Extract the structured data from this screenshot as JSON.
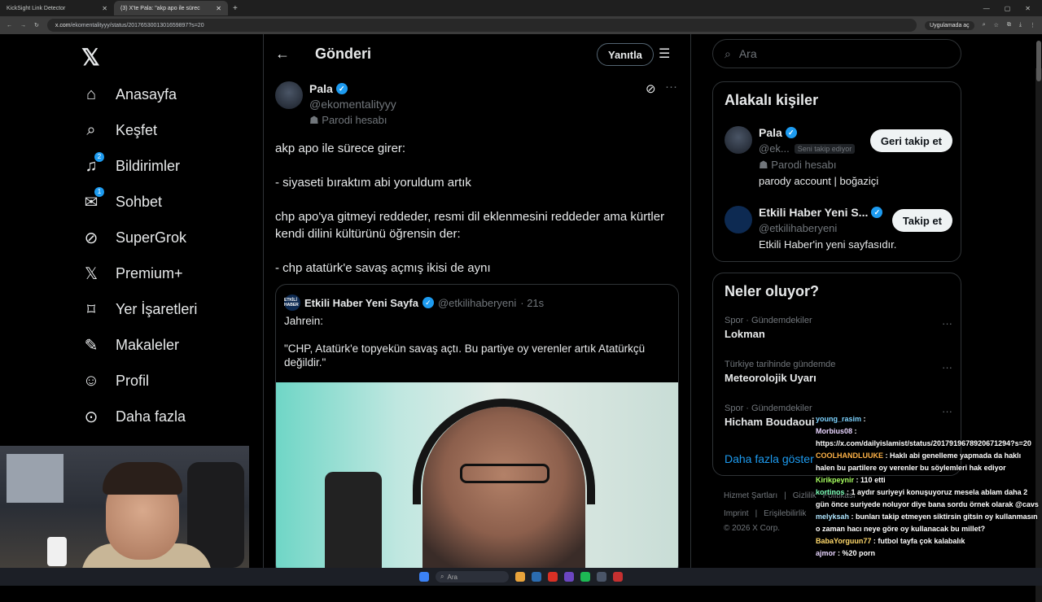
{
  "browser": {
    "tabs": [
      {
        "label": "KickSight Link Detector"
      },
      {
        "label": "(3) X'te Pala: \"akp apo ile sürec"
      }
    ],
    "url_host": "x.com",
    "url_path": "/ekomentalityyy/status/2017653001301659897?s=20",
    "open_in_app": "Uygulamada aç"
  },
  "sidebar": {
    "items": [
      {
        "label": "Anasayfa",
        "icon": "home-icon"
      },
      {
        "label": "Keşfet",
        "icon": "search-icon"
      },
      {
        "label": "Bildirimler",
        "icon": "bell-icon",
        "badge": "2"
      },
      {
        "label": "Sohbet",
        "icon": "mail-icon",
        "badge": "1"
      },
      {
        "label": "SuperGrok",
        "icon": "grok-icon"
      },
      {
        "label": "Premium+",
        "icon": "x-icon"
      },
      {
        "label": "Yer İşaretleri",
        "icon": "bookmark-icon"
      },
      {
        "label": "Makaleler",
        "icon": "article-icon"
      },
      {
        "label": "Profil",
        "icon": "profile-icon"
      },
      {
        "label": "Daha fazla",
        "icon": "more-circle-icon"
      }
    ]
  },
  "header": {
    "title": "Gönderi",
    "reply_label": "Yanıtla"
  },
  "tweet": {
    "name": "Pala",
    "handle": "@ekomentalityyy",
    "parody": "Parodi hesabı",
    "paragraphs": [
      "akp apo ile sürece girer:",
      "- siyaseti bıraktım abi yoruldum artık",
      "chp apo'ya gitmeyi reddeder, resmi dil eklenmesini reddeder ama kürtler kendi dilini kültürünü öğrensin der:",
      "- chp atatürk'e savaş açmış ikisi de aynı"
    ]
  },
  "quote": {
    "avatar_text": "ETKİLİ HABER",
    "name": "Etkili Haber Yeni Sayfa",
    "handle": "@etkilihaberyeni",
    "time": "· 21s",
    "paragraphs": [
      "Jahrein:",
      "\"CHP, Atatürk'e topyekün savaş açtı. Bu partiye oy verenler artık Atatürkçü değildir.\""
    ]
  },
  "search": {
    "placeholder": "Ara"
  },
  "related": {
    "title": "Alakalı kişiler",
    "people": [
      {
        "name": "Pala",
        "handle": "@ek...",
        "follows_you": "Seni takip ediyor",
        "parody": "Parodi hesabı",
        "bio": "parody account | boğaziçi",
        "button": "Geri takip et"
      },
      {
        "name": "Etkili Haber Yeni S...",
        "handle": "@etkilihaberyeni",
        "bio": "Etkili Haber'in yeni sayfasıdır.",
        "button": "Takip et"
      }
    ]
  },
  "trends": {
    "title": "Neler oluyor?",
    "items": [
      {
        "meta": "Spor · Gündemdekiler",
        "name": "Lokman"
      },
      {
        "meta": "Türkiye tarihinde gündemde",
        "name": "Meteorolojik Uyarı"
      },
      {
        "meta": "Spor · Gündemdekiler",
        "name": "Hicham Boudaoui"
      }
    ],
    "show_more": "Daha fazla göster"
  },
  "footer": {
    "row1": [
      "Hizmet Şartları",
      "|",
      "Gizlilik",
      "Politikası"
    ],
    "row2": [
      "Imprint",
      "|",
      "Erişilebilirlik"
    ],
    "copyright": "© 2026 X Corp."
  },
  "chat": [
    {
      "user": "young_rasim",
      "text": ":"
    },
    {
      "user": "Morbius08",
      "text": ": https://x.com/dailyislamist/status/2017919678920671294?s=20"
    },
    {
      "user": "COOLHANDLUUKE",
      "text": ": Haklı abi genelleme yapmada da haklı halen bu partilere oy verenler bu söylemleri hak ediyor"
    },
    {
      "user": "Kirikpeynir",
      "text": ": 110 etti"
    },
    {
      "user": "kortinos",
      "text": ": 1 aydır suriyeyi konuşuyoruz mesela ablam daha 2 gün önce suriyede noluyor diye bana sordu örnek olarak @cavs"
    },
    {
      "user": "melyksah",
      "text": ": bunları takip etmeyen siktirsin gitsin oy kullanmasın o zaman hacı neye göre oy kullanacak bu millet?"
    },
    {
      "user": "BabaYorguun77",
      "text": ": futbol tayfa çok kalabalık"
    },
    {
      "user": "ajmor",
      "text": ": %20 porn"
    }
  ],
  "taskbar": {
    "search_placeholder": "Ara"
  }
}
